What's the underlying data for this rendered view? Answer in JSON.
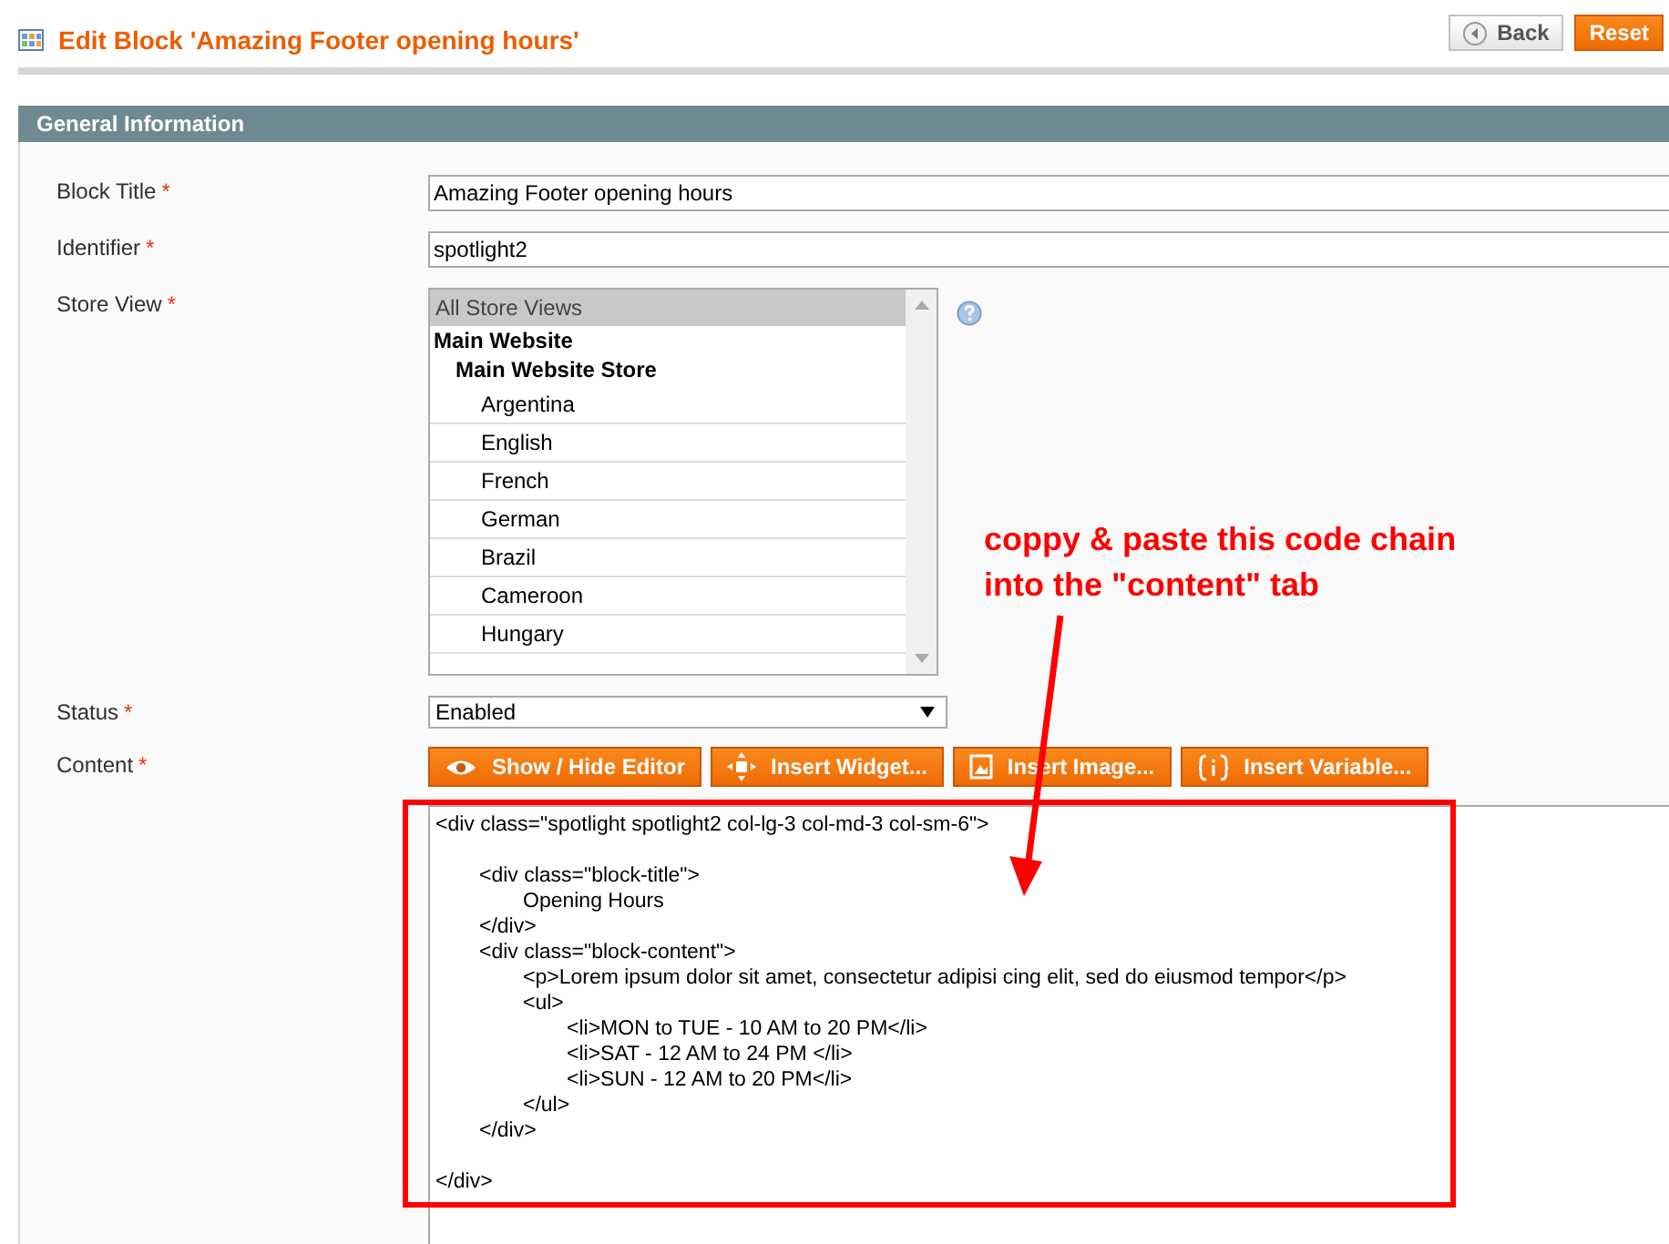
{
  "page_title": "Edit Block 'Amazing Footer opening hours'",
  "header_buttons": [
    {
      "label": "Back",
      "kind": "back"
    },
    {
      "label": "Reset",
      "kind": "primary"
    }
  ],
  "section_title": "General Information",
  "fields": [
    {
      "label": "Block Title",
      "required_mark": "*",
      "kind": "text",
      "value": "Amazing Footer opening hours"
    },
    {
      "label": "Identifier",
      "required_mark": "*",
      "kind": "text",
      "value": "spotlight2"
    },
    {
      "label": "Store View",
      "required_mark": "*",
      "kind": "multiselect",
      "options": [
        {
          "label": "All Store Views",
          "kind": "all",
          "selected": true
        },
        {
          "label": "Main Website",
          "kind": "website",
          "selected": false
        },
        {
          "label": "Main Website Store",
          "kind": "store",
          "selected": false
        },
        {
          "label": "Argentina",
          "kind": "view",
          "selected": false
        },
        {
          "label": "English",
          "kind": "view",
          "selected": false
        },
        {
          "label": "French",
          "kind": "view",
          "selected": false
        },
        {
          "label": "German",
          "kind": "view",
          "selected": false
        },
        {
          "label": "Brazil",
          "kind": "view",
          "selected": false
        },
        {
          "label": "Cameroon",
          "kind": "view",
          "selected": false
        },
        {
          "label": "Hungary",
          "kind": "view",
          "selected": false
        }
      ]
    },
    {
      "label": "Status",
      "required_mark": "*",
      "kind": "select",
      "value": "Enabled"
    },
    {
      "label": "Content",
      "required_mark": "*",
      "kind": "editor",
      "toolbar": [
        {
          "label": "Show / Hide Editor",
          "kind": "eye"
        },
        {
          "label": "Insert Widget...",
          "kind": "widget"
        },
        {
          "label": "Insert Image...",
          "kind": "image"
        },
        {
          "label": "Insert Variable...",
          "kind": "variable"
        }
      ],
      "value": "<div class=\"spotlight spotlight2 col-lg-3 col-md-3 col-sm-6\">\n\n\t<div class=\"block-title\">\n\t\tOpening Hours\n\t</div>\n\t<div class=\"block-content\">\n\t\t<p>Lorem ipsum dolor sit amet, consectetur adipisi cing elit, sed do eiusmod tempor</p>\n\t\t<ul>\n\t\t\t<li>MON to TUE - 10 AM to 20 PM</li>\n\t\t\t<li>SAT - 12 AM to 24 PM </li>\n\t\t\t<li>SUN - 12 AM to 20 PM</li>\n\t\t</ul>\n\t</div>\n\n</div>"
    }
  ],
  "annotation": {
    "lines": [
      "coppy & paste this code chain",
      "into the \"content\" tab"
    ]
  }
}
